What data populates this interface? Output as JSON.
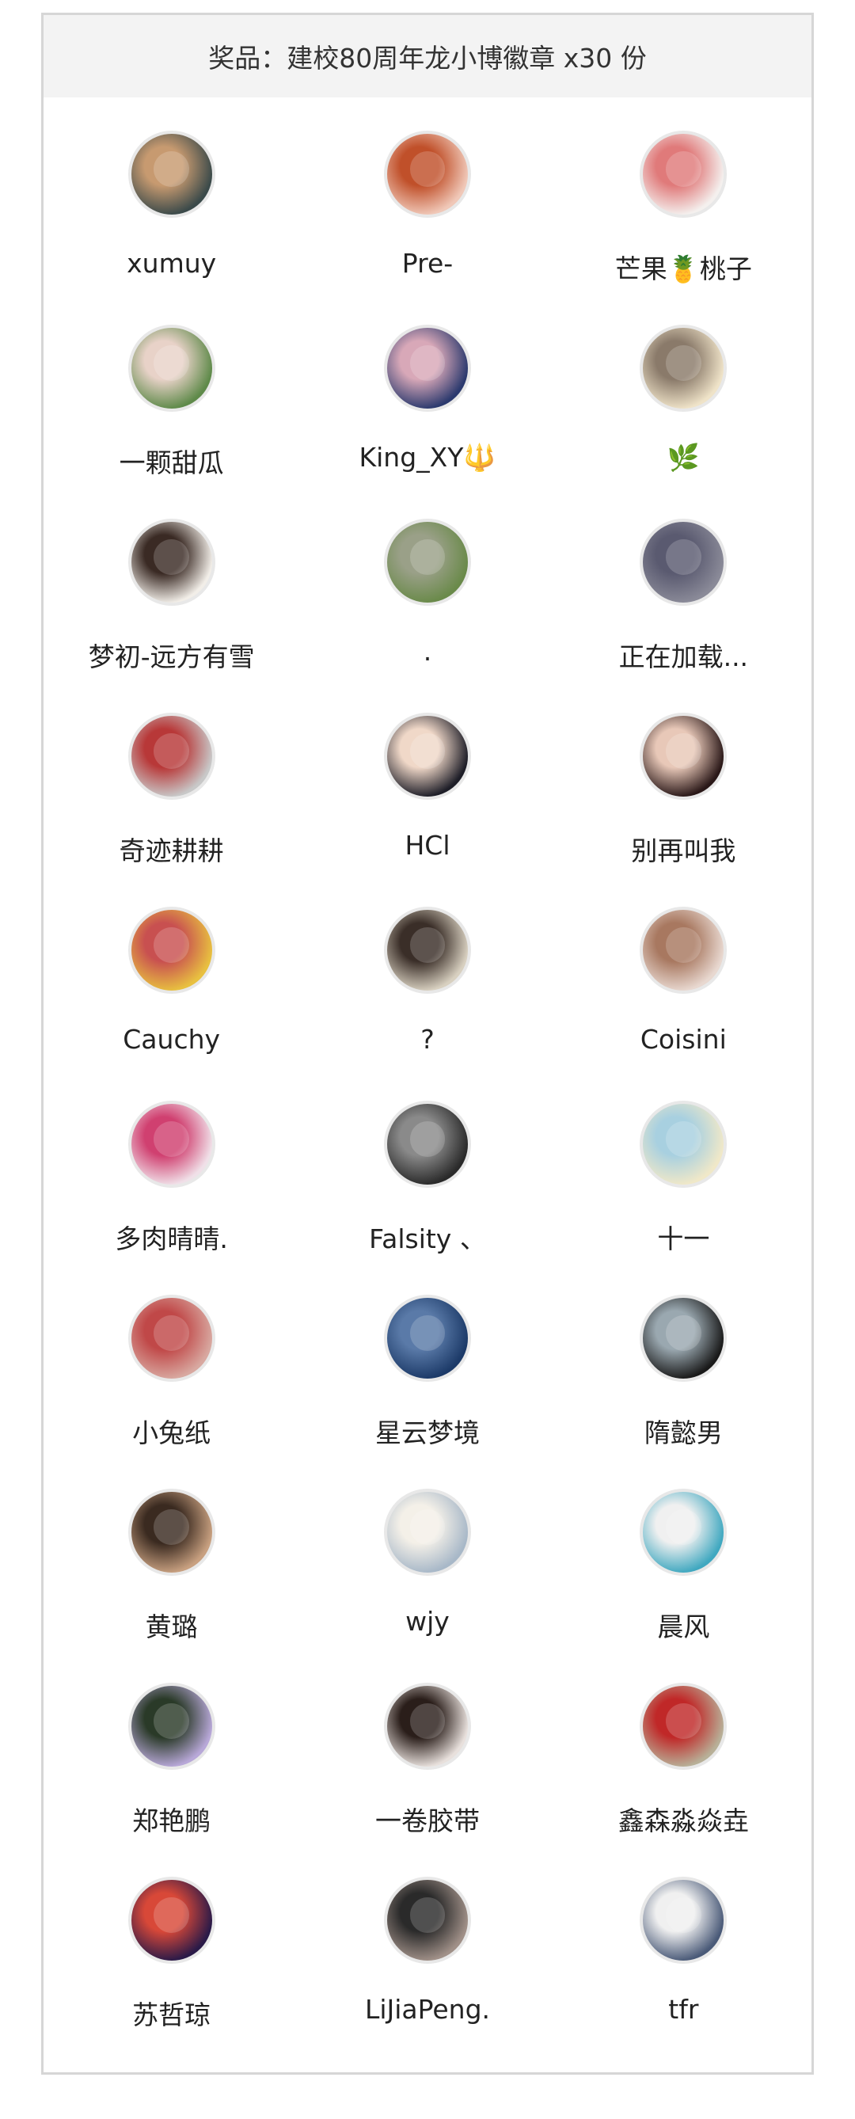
{
  "banner": {
    "text": "奖品：建校80周年龙小博徽章 x30 份"
  },
  "winners": [
    {
      "name": "xumuy",
      "avatar_colors": [
        "#3b4a4a",
        "#c79a70"
      ]
    },
    {
      "name": "Pre-",
      "avatar_colors": [
        "#f0c8b8",
        "#c0502a"
      ]
    },
    {
      "name": "芒果🍍桃子",
      "avatar_colors": [
        "#f4f0ee",
        "#e07a7a"
      ]
    },
    {
      "name": "一颗甜瓜",
      "avatar_colors": [
        "#5f8a4a",
        "#e8d2c8"
      ]
    },
    {
      "name": "King_XY🔱",
      "avatar_colors": [
        "#2c3a6e",
        "#d8a8b8"
      ]
    },
    {
      "name": "🌿",
      "avatar_colors": [
        "#efe3c8",
        "#8a7a6a"
      ]
    },
    {
      "name": "梦初-远方有雪",
      "avatar_colors": [
        "#f2eee8",
        "#3a2a24"
      ]
    },
    {
      "name": ".",
      "avatar_colors": [
        "#6a8a4a",
        "#9aa088"
      ]
    },
    {
      "name": "正在加载...",
      "avatar_colors": [
        "#8a8a98",
        "#5a5a70"
      ]
    },
    {
      "name": "奇迹耕耕",
      "avatar_colors": [
        "#c8c8c8",
        "#b83838"
      ]
    },
    {
      "name": "HCl",
      "avatar_colors": [
        "#1e1e28",
        "#f0d8c8"
      ]
    },
    {
      "name": "别再叫我",
      "avatar_colors": [
        "#2a1818",
        "#e8c8b8"
      ]
    },
    {
      "name": "Cauchy",
      "avatar_colors": [
        "#e8c040",
        "#c85050"
      ]
    },
    {
      "name": "?",
      "avatar_colors": [
        "#d8d0c0",
        "#3a2e28"
      ]
    },
    {
      "name": "Coisini",
      "avatar_colors": [
        "#e8d8d0",
        "#a87860"
      ]
    },
    {
      "name": "多肉晴晴.",
      "avatar_colors": [
        "#f0e0e8",
        "#d04070"
      ]
    },
    {
      "name": "Falsity 、",
      "avatar_colors": [
        "#2a2a2a",
        "#8a8a8a"
      ]
    },
    {
      "name": "十一",
      "avatar_colors": [
        "#f0e8c8",
        "#a8d0e0"
      ]
    },
    {
      "name": "小兔纸",
      "avatar_colors": [
        "#d8a8a0",
        "#c04848"
      ]
    },
    {
      "name": "星云梦境",
      "avatar_colors": [
        "#1c3a68",
        "#5a7aa8"
      ]
    },
    {
      "name": "隋懿男",
      "avatar_colors": [
        "#1a1a1a",
        "#9aa8b0"
      ]
    },
    {
      "name": "黄璐",
      "avatar_colors": [
        "#c8a080",
        "#3a2a20"
      ]
    },
    {
      "name": "wjy",
      "avatar_colors": [
        "#a8b8c8",
        "#f4f0e8"
      ]
    },
    {
      "name": "晨风",
      "avatar_colors": [
        "#40a8c0",
        "#f0f0f0"
      ]
    },
    {
      "name": "郑艳鹏",
      "avatar_colors": [
        "#b8a8d8",
        "#2a3a28"
      ]
    },
    {
      "name": "一卷胶带",
      "avatar_colors": [
        "#e8e0dc",
        "#2a1e1a"
      ]
    },
    {
      "name": "鑫森淼焱垚",
      "avatar_colors": [
        "#b8b098",
        "#c02828"
      ]
    },
    {
      "name": "苏哲琼",
      "avatar_colors": [
        "#2a1a48",
        "#d84838"
      ]
    },
    {
      "name": "LiJiaPeng.",
      "avatar_colors": [
        "#a09088",
        "#2a2a2a"
      ]
    },
    {
      "name": "tfr",
      "avatar_colors": [
        "#4a5a78",
        "#f0f0f0"
      ]
    }
  ]
}
